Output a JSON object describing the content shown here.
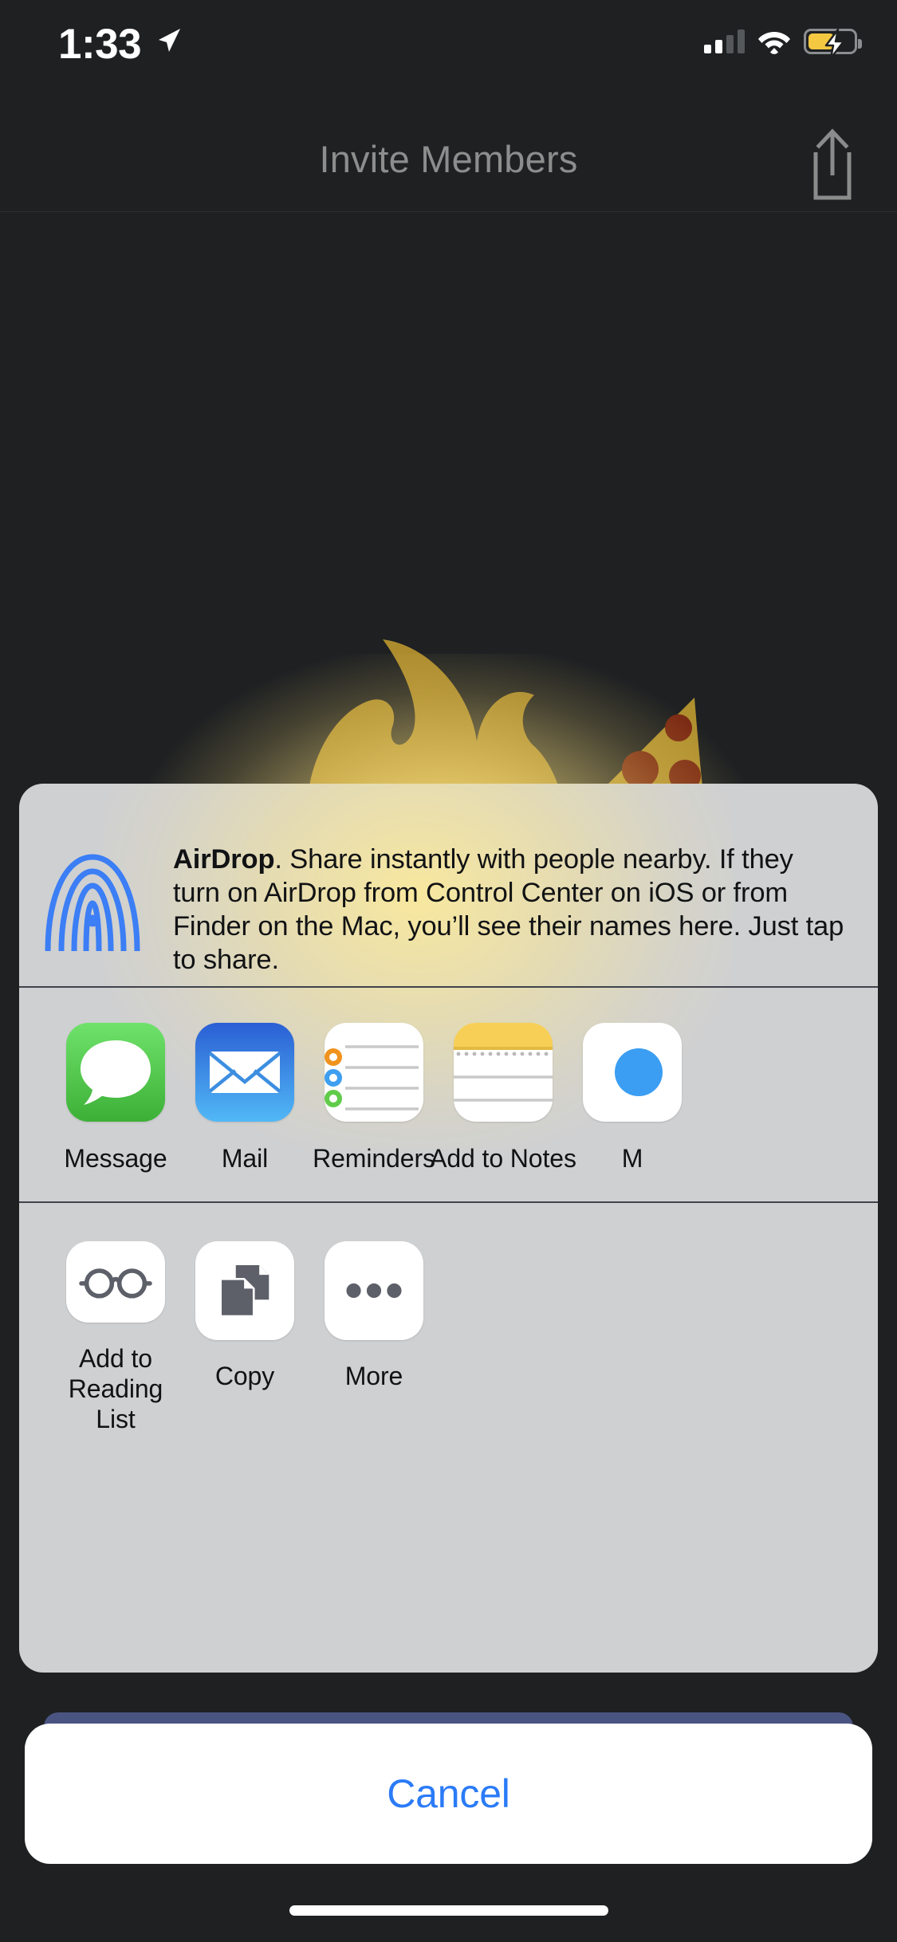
{
  "status_bar": {
    "time": "1:33",
    "location_icon": "location-arrow-icon",
    "cellular_icon": "cellular-signal-icon",
    "cellular_bars_filled": 2,
    "cellular_bars_total": 4,
    "wifi_icon": "wifi-icon",
    "battery_icon": "battery-charging-icon",
    "battery_color": "#f5c842",
    "battery_level_percent": 52
  },
  "nav_bar": {
    "title": "Invite Members",
    "title_color": "#8d8d8d",
    "share_icon": "share-upload-icon"
  },
  "background": {
    "flame_icon": "flame-illustration",
    "flame_color": "#a8862a",
    "pizza_icon": "pizza-slice-illustration",
    "pizza_crust_color": "#b08f2f",
    "pizza_pepperoni_color": "#7a2812",
    "glow_color": "#ffe98c"
  },
  "share_sheet": {
    "background_color": "#cfd0d2",
    "airdrop": {
      "icon": "airdrop-icon",
      "icon_color": "#3b7ef5",
      "title": "AirDrop",
      "body": ". Share instantly with people nearby. If they turn on AirDrop from Control Center on iOS or from Finder on the Mac, you’ll see their names here. Just tap to share."
    },
    "apps": [
      {
        "label": "Message",
        "icon": "messages-app-icon",
        "color": "#5bd257"
      },
      {
        "label": "Mail",
        "icon": "mail-app-icon",
        "color": "#2a7df4"
      },
      {
        "label": "Reminders",
        "icon": "reminders-app-icon",
        "color": "#ffffff"
      },
      {
        "label": "Add to Notes",
        "icon": "notes-app-icon",
        "color": "#f7cf56"
      },
      {
        "label": "M",
        "icon": "partial-app-icon",
        "color": "#ffffff"
      }
    ],
    "actions": [
      {
        "label": "Add to\nReading List",
        "icon": "glasses-icon"
      },
      {
        "label": "Copy",
        "icon": "copy-documents-icon"
      },
      {
        "label": "More",
        "icon": "more-ellipsis-icon"
      }
    ]
  },
  "cancel": {
    "label": "Cancel",
    "color": "#2b7bf7"
  },
  "home_indicator": "home-indicator-bar"
}
